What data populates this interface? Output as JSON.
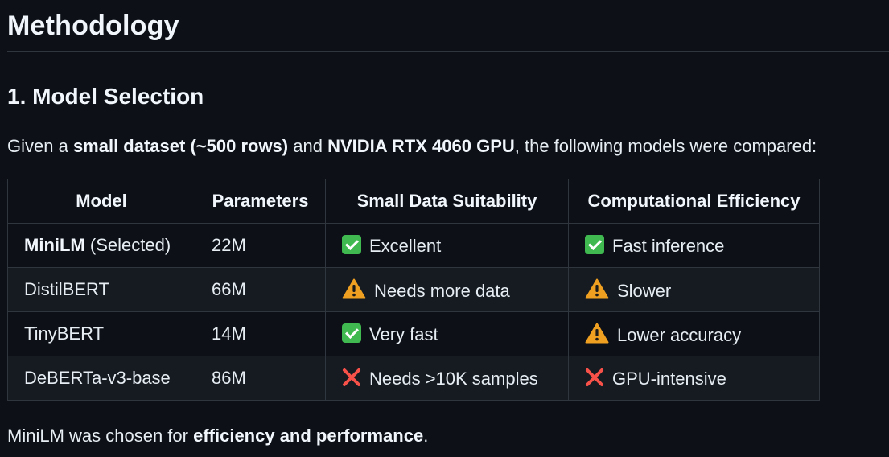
{
  "heading": "Methodology",
  "section": {
    "title": "1. Model Selection",
    "intro": {
      "p1": "Given a ",
      "b1": "small dataset (~500 rows)",
      "p2": " and ",
      "b2": "NVIDIA RTX 4060 GPU",
      "p3": ", the following models were compared:"
    },
    "table": {
      "headers": [
        "Model",
        "Parameters",
        "Small Data Suitability",
        "Computational Efficiency"
      ],
      "rows": [
        {
          "model_bold": "MiniLM",
          "model_rest": " (Selected)",
          "params": "22M",
          "suit_icon": "check-icon",
          "suit": "Excellent",
          "eff_icon": "check-icon",
          "eff": "Fast inference"
        },
        {
          "model_bold": "",
          "model_rest": "DistilBERT",
          "params": "66M",
          "suit_icon": "warning-icon",
          "suit": "Needs more data",
          "eff_icon": "warning-icon",
          "eff": "Slower"
        },
        {
          "model_bold": "",
          "model_rest": "TinyBERT",
          "params": "14M",
          "suit_icon": "check-icon",
          "suit": "Very fast",
          "eff_icon": "warning-icon",
          "eff": "Lower accuracy"
        },
        {
          "model_bold": "",
          "model_rest": "DeBERTa-v3-base",
          "params": "86M",
          "suit_icon": "cross-icon",
          "suit": "Needs >10K samples",
          "eff_icon": "cross-icon",
          "eff": "GPU-intensive"
        }
      ]
    },
    "outro": {
      "p1": "MiniLM was chosen for ",
      "b1": "efficiency and performance",
      "p2": "."
    }
  },
  "colors": {
    "background": "#0d1117",
    "check": "#3fb950",
    "warning": "#f0a020",
    "cross": "#f85149"
  }
}
